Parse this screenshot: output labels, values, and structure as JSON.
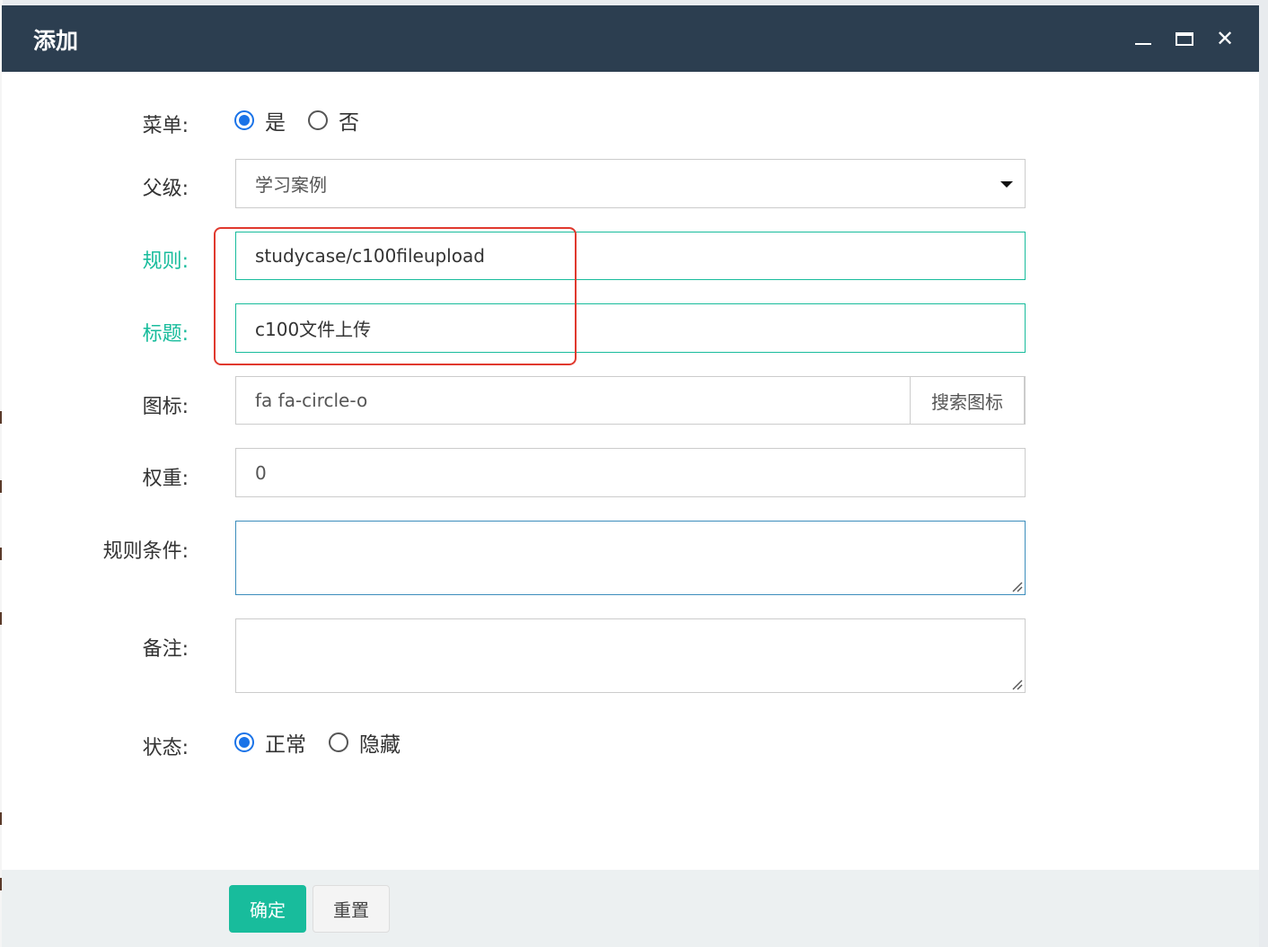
{
  "dialog": {
    "title": "添加",
    "window_controls": {
      "minimize_icon": "minimize-icon",
      "maximize_icon": "maximize-icon",
      "close_icon": "close-icon",
      "close_glyph": "✕"
    }
  },
  "form": {
    "menu": {
      "label": "菜单:",
      "options": [
        "是",
        "否"
      ],
      "selected": "是"
    },
    "parent": {
      "label": "父级:",
      "value": "学习案例"
    },
    "rule": {
      "label": "规则:",
      "value": "studycase/c100fileupload"
    },
    "title": {
      "label": "标题:",
      "value": "c100文件上传"
    },
    "icon": {
      "label": "图标:",
      "value": "fa fa-circle-o",
      "button": "搜索图标"
    },
    "weight": {
      "label": "权重:",
      "value": "0"
    },
    "condition": {
      "label": "规则条件:",
      "value": ""
    },
    "remark": {
      "label": "备注:",
      "value": ""
    },
    "status": {
      "label": "状态:",
      "options": [
        "正常",
        "隐藏"
      ],
      "selected": "正常"
    }
  },
  "footer": {
    "ok": "确定",
    "reset": "重置"
  },
  "colors": {
    "titlebar": "#2c3e50",
    "valid": "#18bc9c",
    "radio_selected": "#1a73e8",
    "annotation": "#e0392e"
  }
}
